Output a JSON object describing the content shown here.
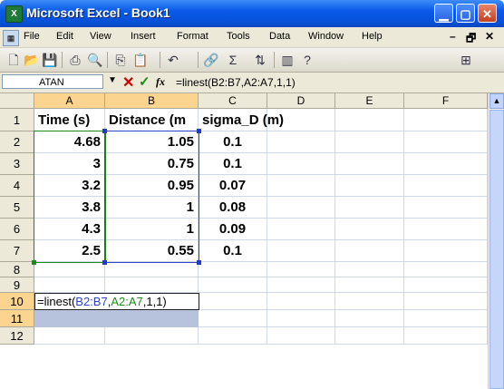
{
  "window": {
    "title": "Microsoft Excel - Book1",
    "app_icon": "excel-icon",
    "controls": [
      "minimize-icon",
      "maximize-icon",
      "close-icon"
    ]
  },
  "menu": {
    "items": [
      "File",
      "Edit",
      "View",
      "Insert",
      "Format",
      "Tools",
      "Data",
      "Window",
      "Help"
    ],
    "doc_controls": [
      "–",
      "✕"
    ]
  },
  "toolbar": {
    "icons": [
      "new-icon",
      "open-icon",
      "save-icon",
      "print-icon",
      "research-icon",
      "copy-icon",
      "paste-icon",
      "undo-icon",
      "hyperlink-icon",
      "autosum-icon",
      "sort-ascending-icon",
      "chart-wizard-icon",
      "help-icon",
      "borders-icon"
    ]
  },
  "formula_bar": {
    "name_box": "ATAN",
    "formula": "=linest(B2:B7,A2:A7,1,1)"
  },
  "sheet": {
    "columns": [
      "A",
      "B",
      "C",
      "D",
      "E",
      "F"
    ],
    "rows": [
      "1",
      "2",
      "3",
      "4",
      "5",
      "6",
      "7",
      "8",
      "9",
      "10",
      "11",
      "12"
    ],
    "header_row": [
      "Time (s)",
      "Distance (m",
      "sigma_D (m)"
    ],
    "data": [
      [
        "4.68",
        "1.05",
        "0.1"
      ],
      [
        "3",
        "0.75",
        "0.1"
      ],
      [
        "3.2",
        "0.95",
        "0.07"
      ],
      [
        "3.8",
        "1",
        "0.08"
      ],
      [
        "4.3",
        "1",
        "0.09"
      ],
      [
        "2.5",
        "0.55",
        "0.1"
      ]
    ],
    "editing_cell": {
      "prefix": "=linest(",
      "ref1": "B2:B7",
      "sep1": ",",
      "ref2": "A2:A7",
      "suffix": ",1,1)"
    }
  },
  "colors": {
    "title_bar": "#0751d8",
    "selected_header": "#fbd590",
    "range_border_blue": "#2d43c9",
    "range_border_green": "#1a8a1a"
  }
}
